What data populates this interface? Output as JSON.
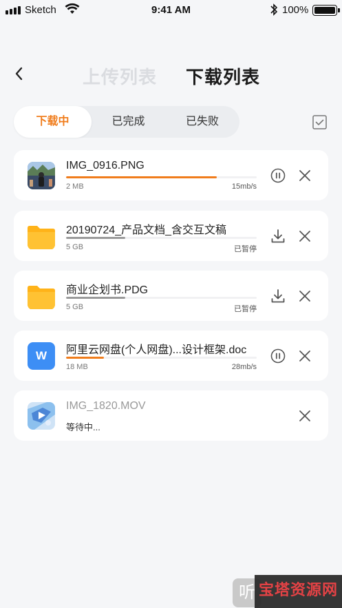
{
  "status_bar": {
    "carrier": "Sketch",
    "time": "9:41 AM",
    "battery": "100%"
  },
  "nav": {
    "upload_tab": "上传列表",
    "download_tab": "下载列表"
  },
  "tabs": [
    "下载中",
    "已完成",
    "已失败"
  ],
  "items": [
    {
      "name": "IMG_0916.PNG",
      "size": "2 MB",
      "rate": "15mb/s",
      "progress": 0.79,
      "bar_color": "#f07c1b",
      "icon": "photo-thumbnail-icon",
      "action": "pause-icon"
    },
    {
      "name": "20190724_产品文档_含交互文稿",
      "size": "5 GB",
      "rate": "已暂停",
      "progress": 0.31,
      "bar_color": "#9a9a9a",
      "icon": "folder-icon",
      "action": "download-icon"
    },
    {
      "name": "商业企划书.PDG",
      "size": "5 GB",
      "rate": "已暂停",
      "progress": 0.31,
      "bar_color": "#9a9a9a",
      "icon": "folder-icon",
      "action": "download-icon"
    },
    {
      "name": "阿里云网盘(个人网盘)...设计框架.doc",
      "size": "18 MB",
      "rate": "28mb/s",
      "progress": 0.2,
      "bar_color": "#f07c1b",
      "icon": "word-doc-icon",
      "action": "pause-icon"
    },
    {
      "name": "IMG_1820.MOV",
      "status": "等待中...",
      "icon": "video-thumbnail-icon"
    }
  ],
  "word_icon_letter": "W",
  "watermark": {
    "text": "宝塔资源网",
    "badge": "听"
  },
  "colors": {
    "accent": "#f07c1b",
    "paused": "#9a9a9a",
    "folder": "#ffb319",
    "word": "#3d8ef5"
  }
}
